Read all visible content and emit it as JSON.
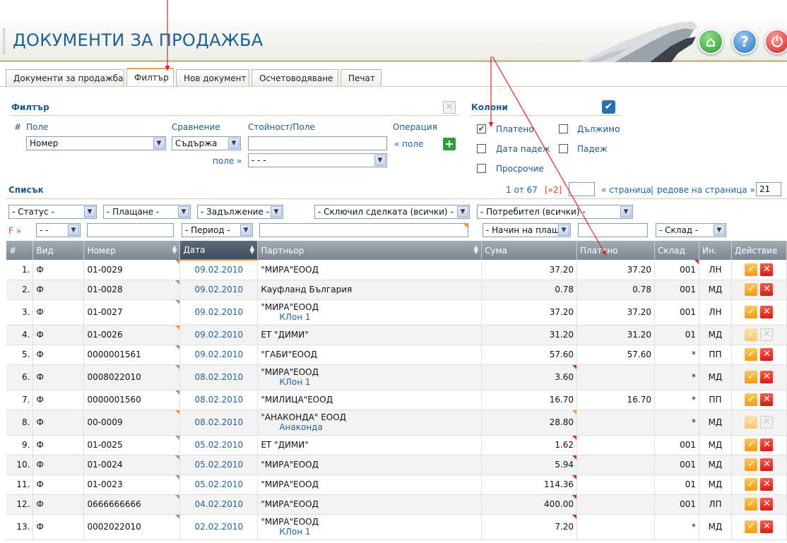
{
  "header": {
    "title": "ДОКУМЕНТИ ЗА ПРОДАЖБА",
    "home_icon": "home-icon",
    "help_icon": "help-icon",
    "power_icon": "power-icon"
  },
  "tabs": [
    {
      "label": "Документи за продажба",
      "active": false
    },
    {
      "label": "Филтър",
      "active": true
    },
    {
      "label": "Нов документ",
      "active": false
    },
    {
      "label": "Осчетоводяване",
      "active": false
    },
    {
      "label": "Печат",
      "active": false
    }
  ],
  "filter": {
    "title": "Филтър",
    "col_num": "#",
    "col_field": "Поле",
    "col_compare": "Сравнение",
    "col_value": "Стойност/Поле",
    "col_operation": "Операция",
    "field_value": "Номер",
    "compare_value": "Съдържа",
    "value_input": "",
    "field_link": "« поле",
    "field2_link": "поле »",
    "field2_value": "- - -"
  },
  "columns_panel": {
    "title": "Колони",
    "options": [
      {
        "label": "Платено",
        "checked": true
      },
      {
        "label": "Дължимо",
        "checked": false
      },
      {
        "label": "Дата падеж",
        "checked": false
      },
      {
        "label": "Падеж",
        "checked": false
      },
      {
        "label": "Просрочие",
        "checked": false
      }
    ]
  },
  "list": {
    "title": "Списък",
    "page_info": "1 от 67",
    "next_link": "[»2]",
    "page_input": "",
    "page_link": "« страница",
    "rows_link": "редове на страница »",
    "rows_value": "21",
    "separator": "|"
  },
  "toolbar_filters": {
    "status": "- Статус -",
    "payment": "- Плащане -",
    "obligation": "- Задължение -",
    "closed_by": "- Сключил сделката (всички) -",
    "user": "- Потребител (всички) -"
  },
  "row_filters": {
    "f_label": "F »",
    "kind": "- -",
    "period": "- Период -",
    "pay_method": "- Начин на плащ",
    "warehouse": "- Склад -"
  },
  "table": {
    "headers": {
      "num": "#",
      "kind": "Вид",
      "number": "Номер",
      "date": "Дата",
      "partner": "Партньор",
      "sum": "Сума",
      "paid": "Платено",
      "warehouse": "Склад",
      "in": "Ин.",
      "action": "Действие"
    },
    "rows": [
      {
        "n": "1.",
        "kind": "Ф",
        "number": "01-0029",
        "date": "09.02.2010",
        "partner": "\"МИРА\"ЕООД",
        "branch": "",
        "sum": "37.20",
        "paid": "37.20",
        "wh": "001",
        "in": "ЛН"
      },
      {
        "n": "2.",
        "kind": "Ф",
        "number": "01-0028",
        "date": "09.02.2010",
        "partner": "Кауфланд България",
        "branch": "",
        "sum": "0.78",
        "paid": "0.78",
        "wh": "001",
        "in": "МД"
      },
      {
        "n": "3.",
        "kind": "Ф",
        "number": "01-0027",
        "date": "09.02.2010",
        "partner": "\"МИРА\"ЕООД",
        "branch": "КЛон 1",
        "sum": "37.20",
        "paid": "37.20",
        "wh": "001",
        "in": "ЛН"
      },
      {
        "n": "4.",
        "kind": "Ф",
        "number": "01-0026",
        "date": "09.02.2010",
        "partner": "ЕТ \"ДИМИ\"",
        "branch": "",
        "sum": "31.20",
        "paid": "31.20",
        "wh": "01",
        "in": "МД"
      },
      {
        "n": "5.",
        "kind": "Ф",
        "number": "0000001561",
        "date": "09.02.2010",
        "partner": "\"ГАБИ\"ЕООД",
        "branch": "",
        "sum": "57.60",
        "paid": "57.60",
        "wh": "*",
        "in": "ПП"
      },
      {
        "n": "6.",
        "kind": "Ф",
        "number": "0008022010",
        "date": "08.02.2010",
        "partner": "\"МИРА\"ЕООД",
        "branch": "КЛон 1",
        "sum": "3.60",
        "paid": "",
        "wh": "*",
        "in": "МД"
      },
      {
        "n": "7.",
        "kind": "Ф",
        "number": "0000001560",
        "date": "08.02.2010",
        "partner": "\"МИЛИЦА\"ЕООД",
        "branch": "",
        "sum": "16.70",
        "paid": "16.70",
        "wh": "*",
        "in": "ПП"
      },
      {
        "n": "8.",
        "kind": "Ф",
        "number": "00-0009",
        "date": "08.02.2010",
        "partner": "\"АНАКОНДА\" ЕООД",
        "branch": "Анаконда",
        "sum": "28.80",
        "paid": "",
        "wh": "*",
        "in": "МД"
      },
      {
        "n": "9.",
        "kind": "Ф",
        "number": "01-0025",
        "date": "05.02.2010",
        "partner": "ЕТ \"ДИМИ\"",
        "branch": "",
        "sum": "1.62",
        "paid": "",
        "wh": "001",
        "in": "МД"
      },
      {
        "n": "10.",
        "kind": "Ф",
        "number": "01-0024",
        "date": "05.02.2010",
        "partner": "\"МИРА\"ЕООД",
        "branch": "",
        "sum": "5.94",
        "paid": "",
        "wh": "001",
        "in": "МД"
      },
      {
        "n": "11.",
        "kind": "Ф",
        "number": "01-0023",
        "date": "05.02.2010",
        "partner": "\"МИРА\"ЕООД",
        "branch": "",
        "sum": "114.36",
        "paid": "",
        "wh": "01",
        "in": "МД"
      },
      {
        "n": "12.",
        "kind": "Ф",
        "number": "0666666666",
        "date": "04.02.2010",
        "partner": "\"МИРА\"ЕООД",
        "branch": "",
        "sum": "400.00",
        "paid": "",
        "wh": "001",
        "in": "ЛП"
      },
      {
        "n": "13.",
        "kind": "Ф",
        "number": "0002022010",
        "date": "02.02.2010",
        "partner": "\"МИРА\"ЕООД",
        "branch": "КЛон 1",
        "sum": "7.20",
        "paid": "",
        "wh": "*",
        "in": "МД"
      }
    ]
  },
  "colors": {
    "title": "#1f5f8b",
    "link": "#1f63a3",
    "accent": "#e38b2c",
    "annotation_arrow": "#e02424"
  }
}
